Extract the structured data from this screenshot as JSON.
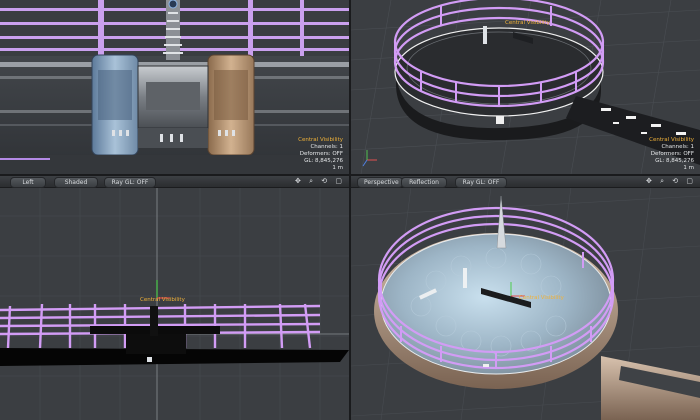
{
  "viewports": {
    "top_left": {
      "info": {
        "selection": "Central Visibility",
        "channels": "Channels: 1",
        "deformers": "Deformers: OFF",
        "gl": "GL: 8,845,276",
        "scale": "1 m"
      }
    },
    "top_right": {
      "info": {
        "selection": "Central Visibility",
        "channels": "Channels: 1",
        "deformers": "Deformers: OFF",
        "gl": "GL: 8,845,276",
        "scale": "1 m"
      },
      "object_label": "Central Visibility"
    },
    "bottom_left": {
      "header": {
        "view": "Left",
        "shading": "Shaded",
        "rendering": "Ray GL: OFF"
      },
      "object_label": "Central Visibility"
    },
    "bottom_right": {
      "header": {
        "view": "Perspective",
        "shading": "Reflection",
        "rendering": "Ray GL: OFF"
      },
      "object_label": "Central Visibility"
    }
  },
  "header_icons": "✥ ⌕ ⟲ ▢",
  "colors": {
    "rail": "#c98cf0",
    "label": "#f0b23a",
    "grid_bg": "#3b3e42",
    "highlight": "#e9eef2"
  }
}
